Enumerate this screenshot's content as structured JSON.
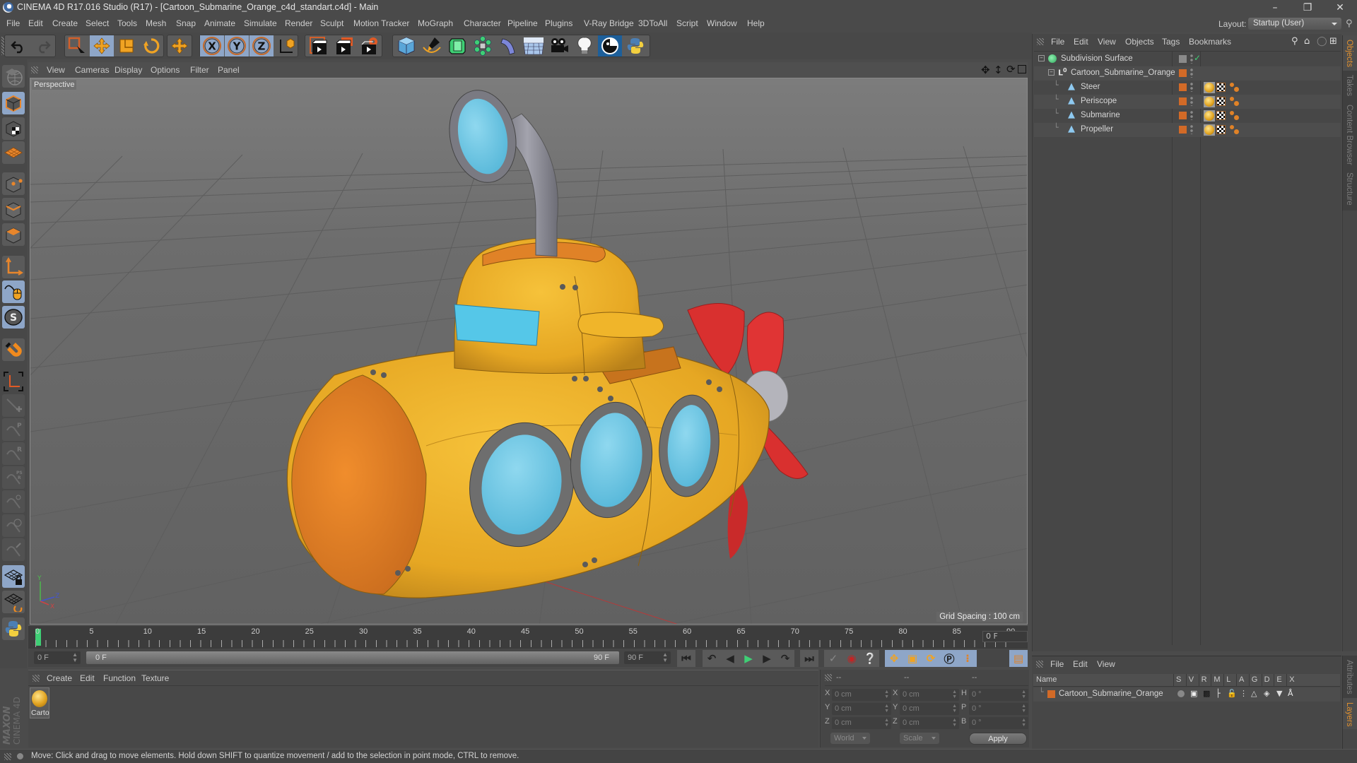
{
  "window": {
    "title": "CINEMA 4D R17.016 Studio (R17) - [Cartoon_Submarine_Orange_c4d_standart.c4d] - Main",
    "controls": [
      "minimize",
      "restore",
      "close"
    ]
  },
  "menubar": {
    "items": [
      "File",
      "Edit",
      "Create",
      "Select",
      "Tools",
      "Mesh",
      "Snap",
      "Animate",
      "Simulate",
      "Render",
      "Sculpt",
      "Motion Tracker",
      "MoGraph",
      "Character",
      "Pipeline",
      "Plugins",
      "V-Ray Bridge",
      "3DToAll",
      "Script",
      "Window",
      "Help"
    ],
    "layout_label": "Layout:",
    "layout_value": "Startup (User)"
  },
  "toolbar": {
    "groups": [
      {
        "name": "history",
        "items": [
          "undo-icon",
          "redo-icon"
        ]
      },
      {
        "name": "tools",
        "items": [
          "live-selection-icon",
          "move-icon",
          "scale-icon",
          "rotate-icon"
        ],
        "active": "move-icon"
      },
      {
        "name": "recent",
        "items": [
          "recent-tool-icon"
        ]
      },
      {
        "name": "axis",
        "items": [
          "x-axis-lock-icon",
          "y-axis-lock-icon",
          "z-axis-lock-icon",
          "coordinate-system-icon"
        ]
      },
      {
        "name": "render",
        "items": [
          "render-view-icon",
          "render-picture-viewer-icon",
          "render-settings-icon"
        ]
      },
      {
        "name": "objects",
        "items": [
          "cube-icon",
          "pen-spline-icon",
          "subdivision-surface-icon",
          "cloner-icon",
          "deformer-icon",
          "floor-icon",
          "camera-icon",
          "light-icon",
          "3dtoall-icon",
          "python-icon"
        ]
      }
    ]
  },
  "left_toolbar": {
    "items": [
      "make-editable-icon",
      "model-mode-icon",
      "texture-mode-icon",
      "workplane-mode-icon",
      "points-mode-icon",
      "edges-mode-icon",
      "polygons-mode-icon",
      "enable-axis-icon",
      "tweak-mode-icon",
      "solo-icon",
      "snap-icon",
      "locked-workplane-icon",
      "move-parent-icon",
      "move-position-icon",
      "move-rotation-icon",
      "move-psr-icon",
      "move-points-icon",
      "move-scale-icon",
      "move-children-icon",
      "workplane-lock-icon",
      "workplane-align-icon",
      "python-script-icon"
    ],
    "active": [
      "model-mode-icon",
      "tweak-mode-icon",
      "solo-icon",
      "workplane-lock-icon"
    ]
  },
  "viewport": {
    "menu": [
      "View",
      "Cameras",
      "Display",
      "Options",
      "Filter",
      "Panel"
    ],
    "camera_label": "Perspective",
    "grid_spacing": "Grid Spacing : 100 cm",
    "axis_labels": {
      "x": "X",
      "y": "Y",
      "z": "Z"
    },
    "nav_icons": [
      "pan-icon",
      "dolly-icon",
      "orbit-icon",
      "maximize-icon"
    ],
    "colors": {
      "hull": "#f0b52a",
      "nose": "#e8862c",
      "glass": "#5ec4e4",
      "frame": "#707070",
      "propeller": "#d9302f",
      "periscope": "#8f8f99"
    }
  },
  "timeline": {
    "ticks": [
      "0",
      "5",
      "10",
      "15",
      "20",
      "25",
      "30",
      "35",
      "40",
      "45",
      "50",
      "55",
      "60",
      "65",
      "70",
      "75",
      "80",
      "85",
      "90"
    ],
    "current_frame": "0 F",
    "start_field": "0 F",
    "range_start": "0 F",
    "range_end": "90 F",
    "end_field": "90 F",
    "playhead_position_frame": 0,
    "playback_buttons": [
      "go-to-start-icon",
      "previous-key-icon",
      "previous-frame-icon",
      "play-icon",
      "next-frame-icon",
      "next-key-icon",
      "go-to-end-icon"
    ],
    "record_buttons": [
      "record-icon",
      "autokey-icon",
      "keyframe-selection-icon"
    ],
    "key_buttons": [
      "key-position-icon",
      "key-scale-icon",
      "key-rotation-icon",
      "key-param-icon",
      "key-pla-icon",
      "timeline-icon"
    ]
  },
  "material_manager": {
    "menu": [
      "Create",
      "Edit",
      "Function",
      "Texture"
    ],
    "materials": [
      {
        "name": "Carto"
      }
    ],
    "brand": [
      "MAXON",
      "CINEMA 4D"
    ]
  },
  "coordinates": {
    "headers": [
      "--",
      "--",
      "--"
    ],
    "rows": [
      {
        "pos_label": "X",
        "pos": "0 cm",
        "size_label": "X",
        "size": "0 cm",
        "rot_label": "H",
        "rot": "0 °"
      },
      {
        "pos_label": "Y",
        "pos": "0 cm",
        "size_label": "Y",
        "size": "0 cm",
        "rot_label": "P",
        "rot": "0 °"
      },
      {
        "pos_label": "Z",
        "pos": "0 cm",
        "size_label": "Z",
        "size": "0 cm",
        "rot_label": "B",
        "rot": "0 °"
      }
    ],
    "mode": "World",
    "transform": "Scale",
    "apply_label": "Apply"
  },
  "object_manager": {
    "menu": [
      "File",
      "Edit",
      "View",
      "Objects",
      "Tags",
      "Bookmarks"
    ],
    "objects": [
      {
        "name": "Subdivision Surface",
        "level": 0,
        "icon": "subdivision-surface-icon",
        "tags": []
      },
      {
        "name": "Cartoon_Submarine_Orange",
        "level": 1,
        "icon": "null-object-icon",
        "tags": []
      },
      {
        "name": "Steer",
        "level": 2,
        "icon": "polygon-object-icon",
        "tags": [
          "material-tag",
          "texture-tag",
          "phong-tag"
        ]
      },
      {
        "name": "Periscope",
        "level": 2,
        "icon": "polygon-object-icon",
        "tags": [
          "material-tag",
          "texture-tag",
          "phong-tag"
        ]
      },
      {
        "name": "Submarine",
        "level": 2,
        "icon": "polygon-object-icon",
        "tags": [
          "material-tag",
          "texture-tag",
          "phong-tag"
        ]
      },
      {
        "name": "Propeller",
        "level": 2,
        "icon": "polygon-object-icon",
        "tags": [
          "material-tag",
          "texture-tag",
          "phong-tag"
        ]
      }
    ],
    "side_tabs": [
      "Objects",
      "Takes",
      "Content Browser",
      "Structure"
    ],
    "active_tab": "Objects"
  },
  "layer_manager": {
    "menu": [
      "File",
      "Edit",
      "View"
    ],
    "columns": [
      "Name",
      "S",
      "V",
      "R",
      "M",
      "L",
      "A",
      "G",
      "D",
      "E",
      "X"
    ],
    "layers": [
      {
        "name": "Cartoon_Submarine_Orange",
        "color": "#d26a27"
      }
    ],
    "side_tabs": [
      "Attributes",
      "Layers"
    ],
    "active_tab": "Layers"
  },
  "status_bar": {
    "message": "Move: Click and drag to move elements. Hold down SHIFT to quantize movement / add to the selection in point mode, CTRL to remove."
  }
}
